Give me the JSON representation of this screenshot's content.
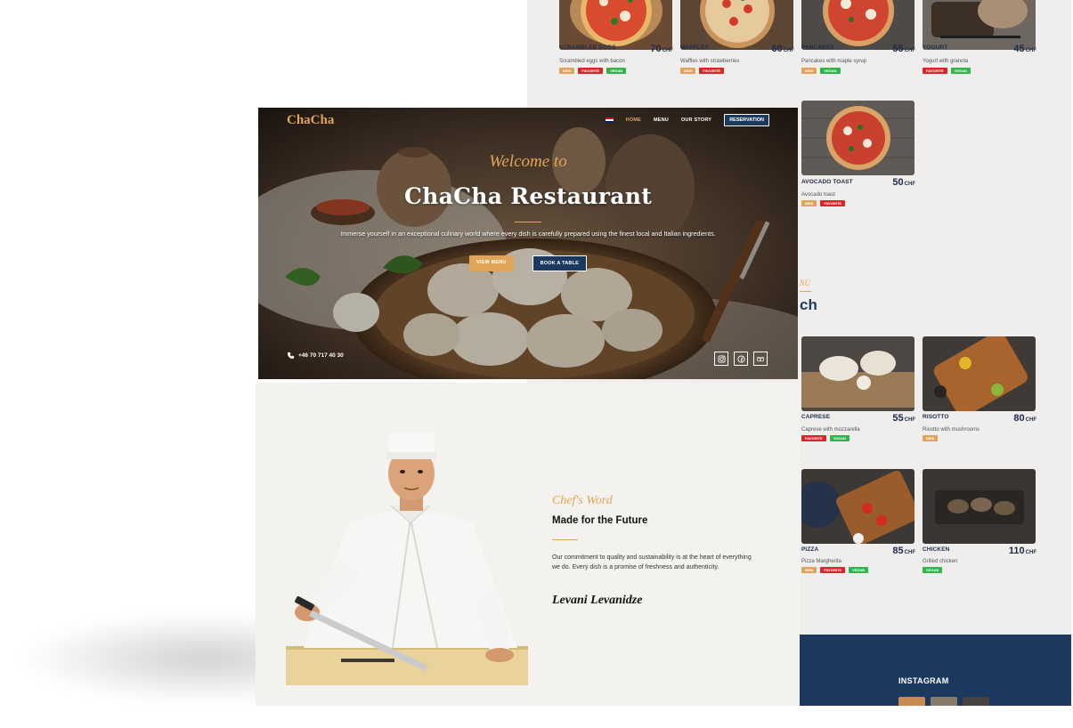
{
  "hero": {
    "logo": "ChaCha",
    "nav": {
      "home": "HOME",
      "menu": "MENU",
      "story": "OUR STORY",
      "reservation": "RESERVATION"
    },
    "welcome": "Welcome to",
    "title": "ChaCha Restaurant",
    "description": "Immerse yourself in an exceptional culinary world where every dish is carefully prepared using the finest local and Italian ingredients.",
    "btn_menu": "VIEW MENU",
    "btn_book": "BOOK A TABLE",
    "phone": "+46 70 717 40 30",
    "socials": [
      "instagram-icon",
      "facebook-icon",
      "tripadvisor-icon"
    ]
  },
  "chef": {
    "subtitle": "Chef's Word",
    "title": "Made for the Future",
    "text": "Our commitment to quality and sustainability is at the heart of everything we do. Every dish is a promise of freshness and authenticity.",
    "signature": "Levani Levanidze"
  },
  "menu": {
    "subtitle": "MENU",
    "heading": "ch",
    "currency": "CHF",
    "items": [
      {
        "name": "SCRAMBLED EGGS",
        "price": "70",
        "desc": "Scrambled eggs with bacon",
        "tags": [
          "NEW",
          "FAVORITE",
          "VEGAN"
        ]
      },
      {
        "name": "WAFFLES",
        "price": "60",
        "desc": "Waffles with strawberries",
        "tags": [
          "NEW",
          "FAVORITE"
        ]
      },
      {
        "name": "PANCAKES",
        "price": "55",
        "desc": "Pancakes with maple syrup",
        "tags": [
          "NEW",
          "VEGAN"
        ]
      },
      {
        "name": "YOGURT",
        "price": "45",
        "desc": "Yogurt with granola",
        "tags": [
          "FAVORITE",
          "VEGAN"
        ]
      },
      {
        "name": "AVOCADO TOAST",
        "price": "50",
        "desc": "Avocado toast",
        "tags": [
          "NEW",
          "FAVORITE"
        ]
      },
      {
        "name": "CAPRESE",
        "price": "55",
        "desc": "Caprese with mozzarella",
        "tags": [
          "FAVORITE",
          "VEGAN"
        ]
      },
      {
        "name": "RISOTTO",
        "price": "80",
        "desc": "Risotto with mushrooms",
        "tags": [
          "NEW"
        ]
      },
      {
        "name": "PIZZA",
        "price": "85",
        "desc": "Pizza Margherita",
        "tags": [
          "NEW",
          "FAVORITE",
          "VEGAN"
        ]
      },
      {
        "name": "CHICKEN",
        "price": "110",
        "desc": "Grilled chicken",
        "tags": [
          "VEGAN"
        ]
      }
    ]
  },
  "footer": {
    "instagram": "INSTAGRAM"
  },
  "colors": {
    "accent": "#e1a458",
    "navy": "#1c3a5f",
    "tag_new": "#e2a25a",
    "tag_favorite": "#d8262b",
    "tag_vegan": "#2fb54a"
  }
}
